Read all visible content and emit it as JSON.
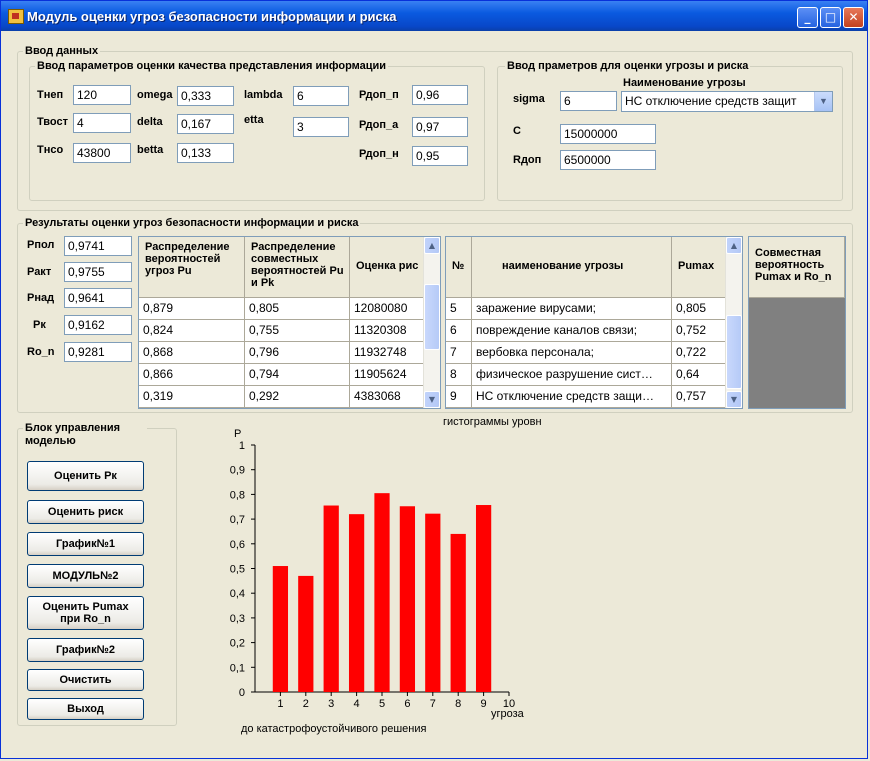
{
  "window": {
    "title": "Модуль оценки угроз безопасности информации и риска",
    "minimize": "_",
    "maximize": "□",
    "close": "✕",
    "icon": "app-icon"
  },
  "input": {
    "group_title": "Ввод данных",
    "quality": {
      "title": "Ввод параметров оценки качества представления информации",
      "fields": [
        {
          "label": "Тнеп",
          "value": "120"
        },
        {
          "label": "Твост",
          "value": "4"
        },
        {
          "label": "Тнсо",
          "value": "43800"
        },
        {
          "label": "omega",
          "value": "0,333"
        },
        {
          "label": "delta",
          "value": "0,167"
        },
        {
          "label": "betta",
          "value": "0,133"
        },
        {
          "label": "lambda",
          "value": "6"
        },
        {
          "label": "etta",
          "value": "3"
        },
        {
          "label": "Рдоп_п",
          "value": "0,96"
        },
        {
          "label": "Рдоп_а",
          "value": "0,97"
        },
        {
          "label": "Рдоп_н",
          "value": "0,95"
        }
      ]
    },
    "threat": {
      "title": "Ввод праметров для оценки угрозы и риска",
      "name_label": "Наименование угрозы",
      "name_value": "НС отключение средств защит",
      "sigma_label": "sigma",
      "sigma_value": "6",
      "c_label": "С",
      "c_value": "15000000",
      "rdop_label": "Rдоп",
      "rdop_value": "6500000"
    }
  },
  "results": {
    "group_title": "Результаты оценки угроз безопасности информации и риска",
    "metrics": [
      {
        "label": "Рпол",
        "value": "0,9741"
      },
      {
        "label": "Ракт",
        "value": "0,9755"
      },
      {
        "label": "Рнад",
        "value": "0,9641"
      },
      {
        "label": "Рк",
        "value": "0,9162"
      },
      {
        "label": "Ro_n",
        "value": "0,9281"
      }
    ],
    "grid1": {
      "headers": [
        "Распределение вероятностей угроз Pu",
        "Распределение совместных вероятностей Pu и Pk",
        "Оценка рис"
      ],
      "rows": [
        [
          "0,879",
          "0,805",
          "12080080"
        ],
        [
          "0,824",
          "0,755",
          "11320308"
        ],
        [
          "0,868",
          "0,796",
          "11932748"
        ],
        [
          "0,866",
          "0,794",
          "11905624"
        ],
        [
          "0,319",
          "0,292",
          "4383068"
        ]
      ]
    },
    "grid2": {
      "headers": [
        "№",
        "наименование угрозы",
        "Pumax"
      ],
      "rows": [
        [
          "5",
          "заражение вирусами;",
          "0,805"
        ],
        [
          "6",
          "повреждение каналов связи;",
          "0,752"
        ],
        [
          "7",
          "вербовка персонала;",
          "0,722"
        ],
        [
          "8",
          "физическое разрушение сист…",
          "0,64"
        ],
        [
          "9",
          "НС отключение средств защи…",
          "0,757"
        ]
      ]
    },
    "grid3": {
      "header": "Совместная вероятность Pumax и Ro_n"
    }
  },
  "control": {
    "group_title": "Блок управления моделью",
    "buttons": [
      "Оценить Рк",
      "Оценить риск",
      "График№1",
      "МОДУЛЬ№2",
      "Оценить Pumax при Ro_n",
      "График№2",
      "Очистить",
      "Выход"
    ]
  },
  "chart_data": {
    "type": "bar",
    "title": "гистограммы уровня угроз",
    "ylabel": "P",
    "xlabel": "угроза",
    "caption": "до  катастрофоустойчивого решения",
    "categories": [
      "1",
      "2",
      "3",
      "4",
      "5",
      "6",
      "7",
      "8",
      "9"
    ],
    "values": [
      0.51,
      0.47,
      0.755,
      0.72,
      0.805,
      0.752,
      0.722,
      0.64,
      0.757
    ],
    "ylim": [
      0,
      1
    ],
    "xlim": [
      0,
      10
    ],
    "yticks": [
      "0",
      "0,1",
      "0,2",
      "0,3",
      "0,4",
      "0,5",
      "0,6",
      "0,7",
      "0,8",
      "0,9",
      "1"
    ],
    "xticks": [
      "1",
      "2",
      "3",
      "4",
      "5",
      "6",
      "7",
      "8",
      "9",
      "10"
    ],
    "bar_color": "#ff0000",
    "grid": false,
    "legend": "none"
  }
}
